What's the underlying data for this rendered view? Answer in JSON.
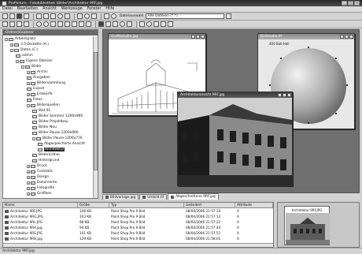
{
  "window": {
    "title": "ProPicture - Fotobibliothek \\Bilder\\Architektur 9RF.jpg"
  },
  "menu": [
    "Datei",
    "Bearbeiten",
    "Ansicht",
    "Werkzeuge",
    "Fenster",
    "Hilfe"
  ],
  "toolbar": {
    "filter_label": "Dateiauswahl",
    "filter_value": "Alle Dateien (*.*)"
  },
  "folders": {
    "title": "Ordner/Explorer",
    "items": [
      {
        "label": "Arbeitsplatz",
        "level": 0,
        "expander": "-"
      },
      {
        "label": "3,5-Diskette (A:)",
        "level": 1,
        "expander": "+"
      },
      {
        "label": "Daten (C:)",
        "level": 1,
        "expander": "-"
      },
      {
        "label": "admin",
        "level": 2,
        "expander": ""
      },
      {
        "label": "Eigene Dateien",
        "level": 2,
        "expander": "-"
      },
      {
        "label": "Bilder",
        "level": 3,
        "expander": "-"
      },
      {
        "label": "Archiv",
        "level": 4,
        "expander": "+"
      },
      {
        "label": "Ausgaben",
        "level": 4,
        "expander": ""
      },
      {
        "label": "Bildersammlung",
        "level": 4,
        "expander": "+"
      },
      {
        "label": "Export",
        "level": 4,
        "expander": ""
      },
      {
        "label": "Entwürfe",
        "level": 4,
        "expander": "+"
      },
      {
        "label": "Fotos",
        "level": 4,
        "expander": ""
      },
      {
        "label": "Bilderquellen",
        "level": 4,
        "expander": "-"
      },
      {
        "label": "Bild 01",
        "level": 5,
        "expander": ""
      },
      {
        "label": "Bilder Sommer 1200x960",
        "level": 5,
        "expander": ""
      },
      {
        "label": "Bilder Projektbau",
        "level": 5,
        "expander": ""
      },
      {
        "label": "Bilder Neu",
        "level": 5,
        "expander": ""
      },
      {
        "label": "Bilder Pause 1200x960",
        "level": 5,
        "expander": ""
      },
      {
        "label": "Bilder Pause 1200x770",
        "level": 5,
        "expander": "-"
      },
      {
        "label": "Abgespeicherte Ansicht",
        "level": 6,
        "expander": ""
      },
      {
        "label": "Architektur",
        "level": 6,
        "expander": "",
        "selected": true
      },
      {
        "label": "Bilderordner",
        "level": 5,
        "expander": ""
      },
      {
        "label": "Hintergrund",
        "level": 5,
        "expander": ""
      },
      {
        "label": "Druck",
        "level": 4,
        "expander": "+"
      },
      {
        "label": "Cocktails",
        "level": 4,
        "expander": "+"
      },
      {
        "label": "Design",
        "level": 4,
        "expander": "+"
      },
      {
        "label": "Dokumente",
        "level": 4,
        "expander": "+"
      },
      {
        "label": "Fotografie",
        "level": 4,
        "expander": "+"
      },
      {
        "label": "Grafiken",
        "level": 4,
        "expander": "+"
      }
    ]
  },
  "workspace": {
    "windows": [
      {
        "title": "Grafikstudie.jpg"
      },
      {
        "title": "Ballstudie.tif"
      },
      {
        "title": "Architekturansicht 9RF.jpg"
      }
    ],
    "ball_caption": "400 Ball-Hell"
  },
  "tabs": [
    {
      "label": "Bildvorlage.jpg"
    },
    {
      "label": "Umbild.tif"
    },
    {
      "label": "Abgeschnittene 9RF.jpg"
    }
  ],
  "filelist": {
    "columns": [
      "Name",
      "Größe",
      "Typ",
      "Geändert",
      "Attribute"
    ],
    "rows": [
      [
        "Architektur 9RF.JPG",
        "108 KB",
        "Paint Shop Pro 9 Bild",
        "08/04/2006 21:57:10",
        "A"
      ],
      [
        "Architektur 9RG.JPG",
        "103 KB",
        "Paint Shop Pro 9 Bild",
        "08/04/2006 21:57:12",
        "A"
      ],
      [
        "Architektur 9RL.JPG",
        "98 KB",
        "Paint Shop Pro 9 Bild",
        "08/04/2006 21:57:22",
        "A"
      ],
      [
        "Architektur 9RA.jpg",
        "94 KB",
        "Paint Shop Pro 9 Bild",
        "08/04/2006 21:57:44",
        "A"
      ],
      [
        "Architektur 9RS.JPG",
        "101 KB",
        "Paint Shop Pro 9 Bild",
        "08/04/2006 21:57:51",
        "A"
      ],
      [
        "Architektur 9RB.jpg",
        "129 KB",
        "Paint Shop Pro 9 Bild",
        "08/04/2006 21:58:01",
        "A"
      ]
    ]
  },
  "preview": {
    "caption": "Architektur 9RF.JPG"
  },
  "status": {
    "text": "Architektur 9RF.jpg"
  }
}
